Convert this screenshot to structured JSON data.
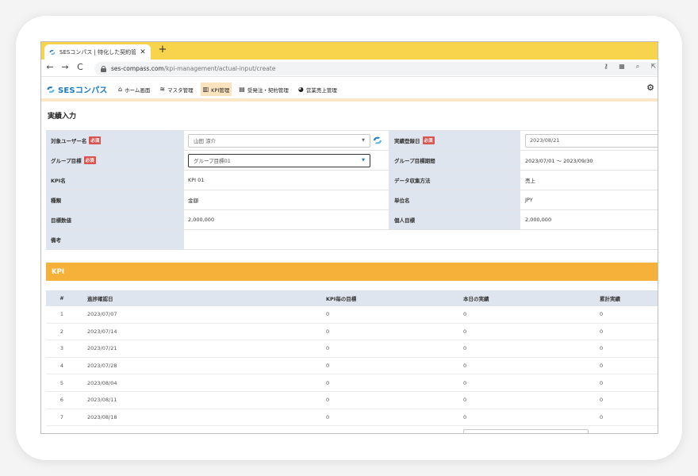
{
  "browser": {
    "tab_title": "SESコンパス | 特化した契約管理・",
    "tab_close": "✕",
    "new_tab": "+",
    "url_domain": "ses-compass.com",
    "url_path": "/kpi-management/actual-input/create",
    "nav_back": "←",
    "nav_forward": "→",
    "nav_reload": "C",
    "icons": [
      "key-icon",
      "translate-icon",
      "zoom-icon",
      "share-icon"
    ]
  },
  "app": {
    "logo_text": "SESコンパス",
    "menu": [
      {
        "label": "ホーム画面",
        "icon": "home-icon"
      },
      {
        "label": "マスタ管理",
        "icon": "database-icon"
      },
      {
        "label": "KPI管理",
        "icon": "bar-chart-icon"
      },
      {
        "label": "受発注・契約管理",
        "icon": "document-icon"
      },
      {
        "label": "営業売上管理",
        "icon": "pie-chart-icon"
      }
    ],
    "settings_icon": "gear-icon"
  },
  "page": {
    "title": "実績入力"
  },
  "form": {
    "required": "必須",
    "user_label": "対象ユーザー名",
    "user_value": "山田 涼介",
    "date_label": "実績登録日",
    "date_value": "2023/08/21",
    "group_label": "グループ目標",
    "group_value": "グループ目標01",
    "period_label": "グループ目標期間",
    "period_value": "2023/07/01 〜 2023/09/30",
    "kpi_label": "KPI名",
    "kpi_value": "KPI 01",
    "method_label": "データ収集方法",
    "method_value": "売上",
    "type_label": "種類",
    "type_value": "金額",
    "unit_label": "単位名",
    "unit_value": "JPY",
    "target_label": "目標数値",
    "target_value": "2,000,000",
    "personal_label": "個人目標",
    "personal_value": "2,000,000",
    "note_label": "備考",
    "note_value": ""
  },
  "kpi": {
    "section_title": "KPI",
    "headers": {
      "no": "#",
      "date": "進捗確認日",
      "target": "KPI毎の目標",
      "today": "本日の実績",
      "total": "累計実績"
    },
    "rows": [
      {
        "no": "1",
        "date": "2023/07/07",
        "target": "0",
        "today": "0",
        "total": "0"
      },
      {
        "no": "2",
        "date": "2023/07/14",
        "target": "0",
        "today": "0",
        "total": "0"
      },
      {
        "no": "3",
        "date": "2023/07/21",
        "target": "0",
        "today": "0",
        "total": "0"
      },
      {
        "no": "4",
        "date": "2023/07/28",
        "target": "0",
        "today": "0",
        "total": "0"
      },
      {
        "no": "5",
        "date": "2023/08/04",
        "target": "0",
        "today": "0",
        "total": "0"
      },
      {
        "no": "6",
        "date": "2023/08/11",
        "target": "0",
        "today": "0",
        "total": "0"
      },
      {
        "no": "7",
        "date": "2023/08/18",
        "target": "0",
        "today": "0",
        "total": "0"
      }
    ]
  },
  "colors": {
    "tab_bar": "#f7d44c",
    "kpi_header": "#f6b13a",
    "label_bg": "#dfe5ee",
    "required": "#d9534f",
    "brand": "#1a7ac4"
  }
}
